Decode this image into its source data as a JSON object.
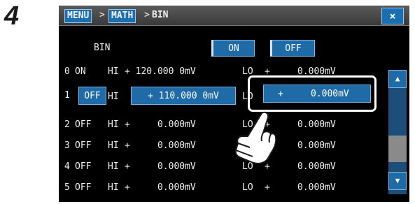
{
  "step": "4",
  "breadcrumb": {
    "menu": "MENU",
    "math": "MATH",
    "bin": "BIN",
    "separator": ">"
  },
  "close_label": "×",
  "bin_row": {
    "label": "BIN",
    "on": "ON",
    "off": "OFF"
  },
  "rows": [
    {
      "index": "0",
      "state": "ON",
      "hi_label": "HI",
      "hi_value": "+ 120.000 0mV",
      "lo_label": "LO",
      "lo_value": "+     0.000mV"
    },
    {
      "index": "1",
      "state": "OFF",
      "hi_label": "HI",
      "hi_value": "+ 110.000 0mV",
      "lo_label": "LO",
      "lo_value": "+     0.000mV"
    },
    {
      "index": "2",
      "state": "OFF",
      "hi_label": "HI",
      "hi_value": "+     0.000mV",
      "lo_label": "LO",
      "lo_value": "+     0.000mV"
    },
    {
      "index": "3",
      "state": "OFF",
      "hi_label": "HI",
      "hi_value": "+     0.000mV",
      "lo_label": "LO",
      "lo_value": "+     0.000mV"
    },
    {
      "index": "4",
      "state": "OFF",
      "hi_label": "HI",
      "hi_value": "+     0.000mV",
      "lo_label": "LO",
      "lo_value": "+     0.000mV"
    },
    {
      "index": "5",
      "state": "OFF",
      "hi_label": "HI",
      "hi_value": "+     0.000mV",
      "lo_label": "LO",
      "lo_value": "+     0.000mV"
    }
  ],
  "scroll": {
    "up": "▲",
    "down": "▼"
  },
  "colors": {
    "accent": "#1e6ba8",
    "background": "#000000",
    "titlebar": "#4a4a4a"
  },
  "icons": {
    "pointer": "hand-pointer-icon",
    "close": "close-icon"
  }
}
